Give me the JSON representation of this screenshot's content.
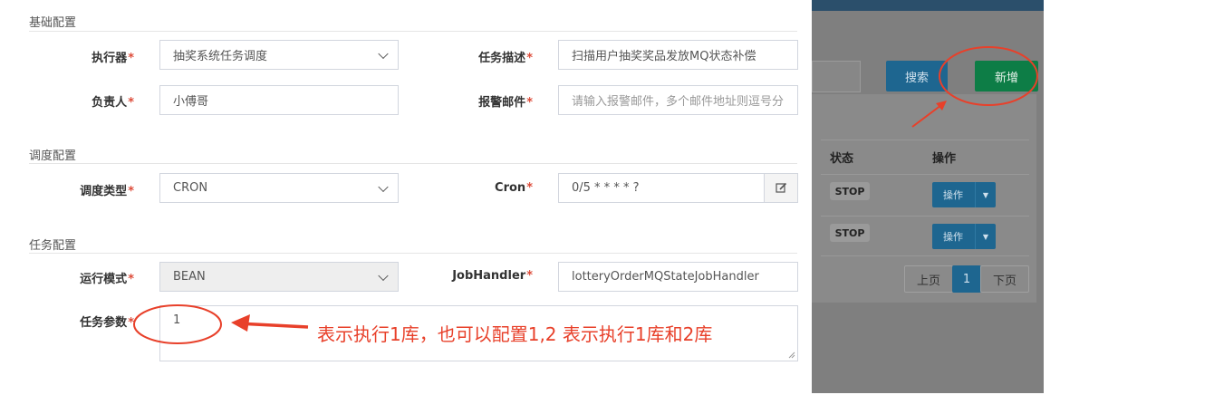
{
  "form": {
    "sections": {
      "basic": "基础配置",
      "schedule": "调度配置",
      "task": "任务配置"
    },
    "executor": {
      "label": "执行器",
      "value": "抽奖系统任务调度"
    },
    "description": {
      "label": "任务描述",
      "value": "扫描用户抽奖奖品发放MQ状态补偿"
    },
    "owner": {
      "label": "负责人",
      "value": "小傅哥"
    },
    "alarm_email": {
      "label": "报警邮件",
      "placeholder": "请输入报警邮件，多个邮件地址则逗号分"
    },
    "schedule_type": {
      "label": "调度类型",
      "value": "CRON"
    },
    "cron": {
      "label": "Cron",
      "value": "0/5 * * * * ?"
    },
    "run_mode": {
      "label": "运行模式",
      "value": "BEAN"
    },
    "job_handler": {
      "label": "JobHandler",
      "value": "lotteryOrderMQStateJobHandler"
    },
    "task_params": {
      "label": "任务参数",
      "value": "1"
    },
    "required_mark": "*"
  },
  "annotation": {
    "text": "表示执行1库，也可以配置1,2 表示执行1库和2库"
  },
  "panel": {
    "search_button": "搜索",
    "add_button": "新增",
    "table_headers": [
      "状态",
      "操作"
    ],
    "rows": [
      {
        "status": "STOP",
        "action": "操作"
      },
      {
        "status": "STOP",
        "action": "操作"
      }
    ],
    "pagination": {
      "prev": "上页",
      "current": "1",
      "next": "下页"
    }
  },
  "colors": {
    "required": "#dd4b39",
    "annotation": "#e8402a",
    "search": "#3c8dbc",
    "add": "#00a65a"
  },
  "icons": {
    "cron_edit": "edit-icon",
    "dropdown": "caret-down-icon",
    "arrow": "arrow-left-icon"
  }
}
